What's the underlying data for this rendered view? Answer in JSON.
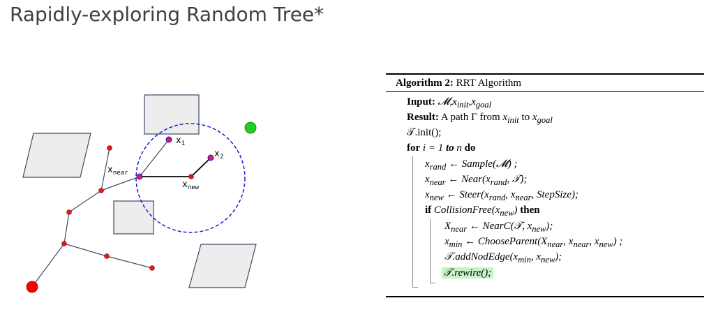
{
  "title": "Rapidly-exploring Random Tree*",
  "diagram": {
    "labels": {
      "x1": "x",
      "x1_sub": "1",
      "x2": "x",
      "x2_sub": "2",
      "xnear": "x",
      "xnear_sub": "near",
      "xnew": "x",
      "xnew_sub": "new"
    },
    "colors": {
      "obstacle_fill": "#ededed",
      "obstacle_stroke": "#3b4a63",
      "node": "#e31a1c",
      "edge": "#3b4a63",
      "circle": "#1a1acc",
      "goal": "#22cc22",
      "start": "#ff0000",
      "near_node": "#d81b60"
    }
  },
  "algorithm": {
    "heading_bold": "Algorithm 2:",
    "heading_text": "RRT Algorithm",
    "input_label": "Input:",
    "input_value": "𝓜,x",
    "result_label": "Result:",
    "result_value": "A path Γ from x",
    "lines": {
      "input": "𝓜, x_init, x_goal",
      "result_pre": "A path Γ from ",
      "result_x1": "x",
      "result_x1_sub": "init",
      "result_mid": " to ",
      "result_x2": "x",
      "result_x2_sub": "goal",
      "init": "𝒯.init();",
      "for_kw": "for",
      "for_body": "i = 1",
      "for_to": "to",
      "for_n": "n",
      "for_do": "do",
      "l1": "x_rand ← Sample(𝓜) ;",
      "l2": "x_near ← Near(x_rand, 𝒯);",
      "l3": "x_new ← Steer(x_rand, x_near, StepSize);",
      "if_kw": "if",
      "if_cond": "CollisionFree(x_new)",
      "if_then": "then",
      "l4": "X_near ← NearC(𝒯, x_new);",
      "l5": "x_min ← ChooseParent(X_near, x_near, x_new) ;",
      "l6": "𝒯.addNodEdge(x_min, x_new);",
      "l7": "𝒯.rewire();"
    },
    "highlight_color": "#c6f3c6"
  }
}
